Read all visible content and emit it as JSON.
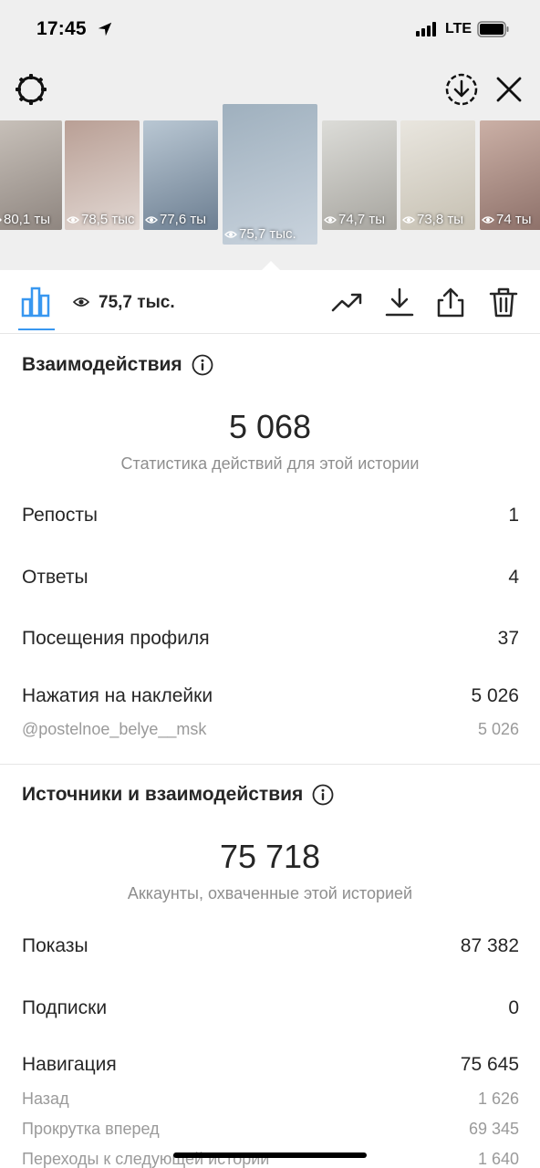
{
  "status_bar": {
    "time": "17:45",
    "network": "LTE"
  },
  "thumbnails": [
    {
      "views": "80,1 ты",
      "colors": [
        "#c9c2bb",
        "#8f8680"
      ]
    },
    {
      "views": "78,5 тыс",
      "colors": [
        "#b99f95",
        "#e2d8d3"
      ]
    },
    {
      "views": "77,6 ты",
      "colors": [
        "#b9c7d3",
        "#6d7f92"
      ]
    },
    {
      "views": "75,7 тыс.",
      "colors": [
        "#9fb0be",
        "#c9d3dd"
      ],
      "active": true
    },
    {
      "views": "74,7 ты",
      "colors": [
        "#dcdcd8",
        "#a7a59f"
      ]
    },
    {
      "views": "73,8 ты",
      "colors": [
        "#e9e6df",
        "#c6c0b2"
      ]
    },
    {
      "views": "74 ты",
      "colors": [
        "#cbb0a6",
        "#8c6f68"
      ]
    }
  ],
  "toolbar": {
    "views": "75,7 тыс."
  },
  "interactions": {
    "title": "Взаимодействия",
    "total": "5 068",
    "subtitle": "Статистика действий для этой истории",
    "rows": [
      {
        "label": "Репосты",
        "value": "1"
      },
      {
        "label": "Ответы",
        "value": "4"
      },
      {
        "label": "Посещения профиля",
        "value": "37"
      },
      {
        "label": "Нажатия на наклейки",
        "value": "5 026"
      }
    ],
    "sticker_detail": {
      "label": "@postelnoe_belye__msk",
      "value": "5 026"
    }
  },
  "sources": {
    "title": "Источники и взаимодействия",
    "total": "75 718",
    "subtitle": "Аккаунты, охваченные этой историей",
    "rows": [
      {
        "label": "Показы",
        "value": "87 382"
      },
      {
        "label": "Подписки",
        "value": "0"
      },
      {
        "label": "Навигация",
        "value": "75 645"
      }
    ],
    "nav_details": [
      {
        "label": "Назад",
        "value": "1 626"
      },
      {
        "label": "Прокрутка вперед",
        "value": "69 345"
      },
      {
        "label": "Переходы к следующей истории",
        "value": "1 640"
      }
    ]
  },
  "colors": {
    "accent": "#3897f0",
    "secondary_text": "#8e8e8e",
    "text": "#262626"
  }
}
